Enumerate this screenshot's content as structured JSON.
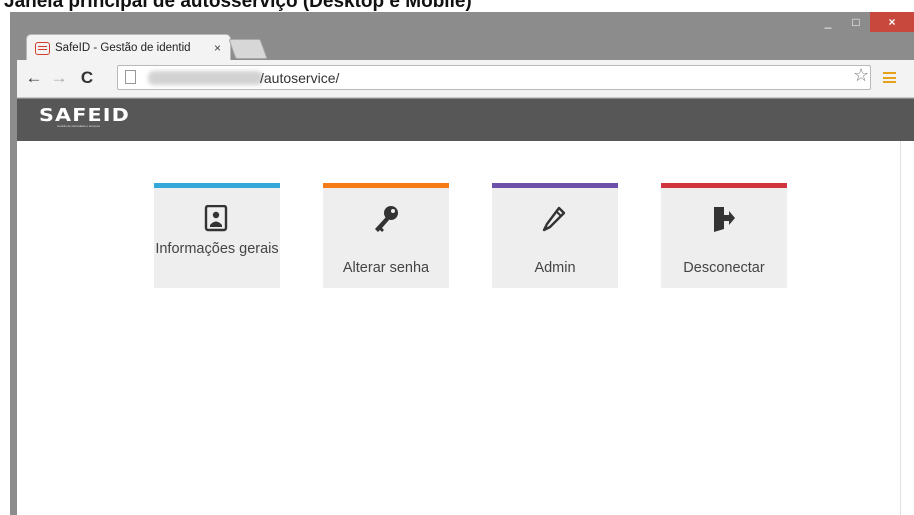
{
  "tab": {
    "title": "SafeID - Gestão de identid",
    "close": "×"
  },
  "window": {
    "minimize": "_",
    "maximize": "□",
    "close": "×"
  },
  "nav": {
    "back": "←",
    "forward": "→",
    "reload": "C"
  },
  "address": {
    "url": "/autoservice/"
  },
  "app": {
    "logo": "SAFEID",
    "tagline": "Gestão de identidade e acessos"
  },
  "tiles": [
    {
      "label": "Informações gerais",
      "color": "#34a8d8",
      "icon": "contact-card-icon"
    },
    {
      "label": "Alterar senha",
      "color": "#f47b16",
      "icon": "key-icon"
    },
    {
      "label": "Admin",
      "color": "#6b4fa8",
      "icon": "pencil-icon"
    },
    {
      "label": "Desconectar",
      "color": "#d1353c",
      "icon": "logout-door-icon"
    }
  ],
  "caption": "Janela principal de autosserviço (Desktop e Mobile)"
}
